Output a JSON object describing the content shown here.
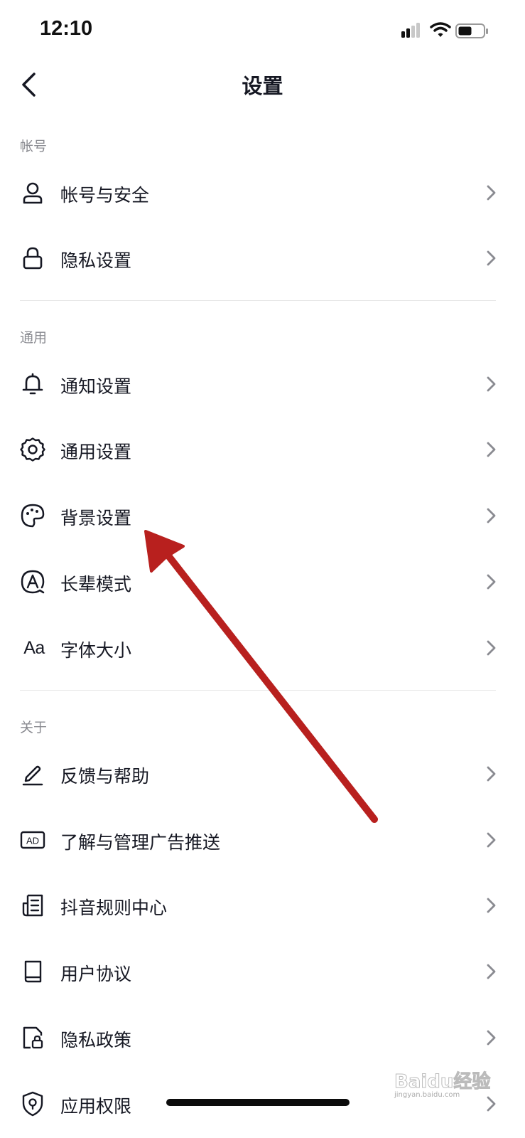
{
  "status_bar": {
    "time": "12:10",
    "icons": [
      "signal-icon",
      "wifi-icon",
      "battery-icon"
    ]
  },
  "nav": {
    "title": "设置",
    "back_icon": "chevron-left-icon"
  },
  "sections": [
    {
      "header": "帐号",
      "items": [
        {
          "label": "帐号与安全",
          "icon": "user-icon"
        },
        {
          "label": "隐私设置",
          "icon": "lock-icon"
        }
      ]
    },
    {
      "header": "通用",
      "items": [
        {
          "label": "通知设置",
          "icon": "bell-icon"
        },
        {
          "label": "通用设置",
          "icon": "gear-icon"
        },
        {
          "label": "背景设置",
          "icon": "palette-icon"
        },
        {
          "label": "长辈模式",
          "icon": "elder-mode-icon"
        },
        {
          "label": "字体大小",
          "icon": "font-size-icon",
          "glyph": "Aa"
        }
      ]
    },
    {
      "header": "关于",
      "items": [
        {
          "label": "反馈与帮助",
          "icon": "pen-icon"
        },
        {
          "label": "了解与管理广告推送",
          "icon": "ad-icon",
          "glyph": "AD"
        },
        {
          "label": "抖音规则中心",
          "icon": "document-icon"
        },
        {
          "label": "用户协议",
          "icon": "book-icon"
        },
        {
          "label": "隐私政策",
          "icon": "privacy-file-icon"
        },
        {
          "label": "应用权限",
          "icon": "shield-icon"
        }
      ]
    }
  ],
  "watermark": {
    "brand": "Baidu经验",
    "sub": "jingyan.baidu.com"
  },
  "colors": {
    "text": "#161823",
    "secondary": "#8a8b91",
    "divider": "#e8e8e8",
    "annotation_arrow": "#b8201e"
  }
}
